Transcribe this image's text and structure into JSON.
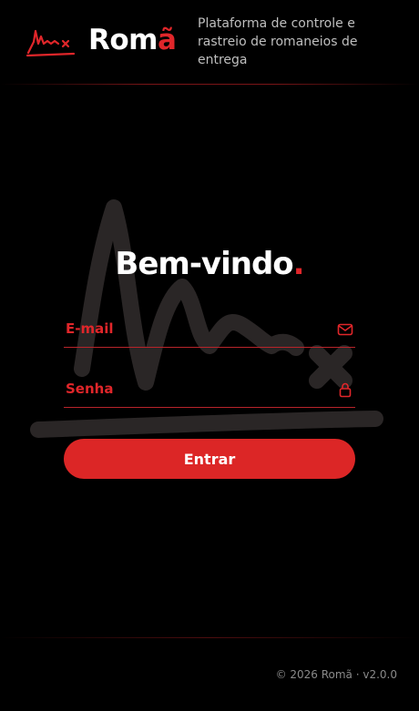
{
  "header": {
    "brand_prefix": "Rom",
    "brand_accent": "ã",
    "tagline": "Plataforma de controle e rastreio de romaneios de entrega",
    "logo_icon": "signal-wave-x-icon"
  },
  "login": {
    "title": "Bem-vindo",
    "title_dot": ".",
    "email_label": "E-mail",
    "email_icon": "envelope-icon",
    "password_label": "Senha",
    "password_icon": "lock-icon",
    "submit_label": "Entrar"
  },
  "footer": {
    "text": "© 2026 Romã · v2.0.0"
  },
  "colors": {
    "accent": "#e0262a",
    "button": "#dc2626",
    "background": "#000000"
  }
}
